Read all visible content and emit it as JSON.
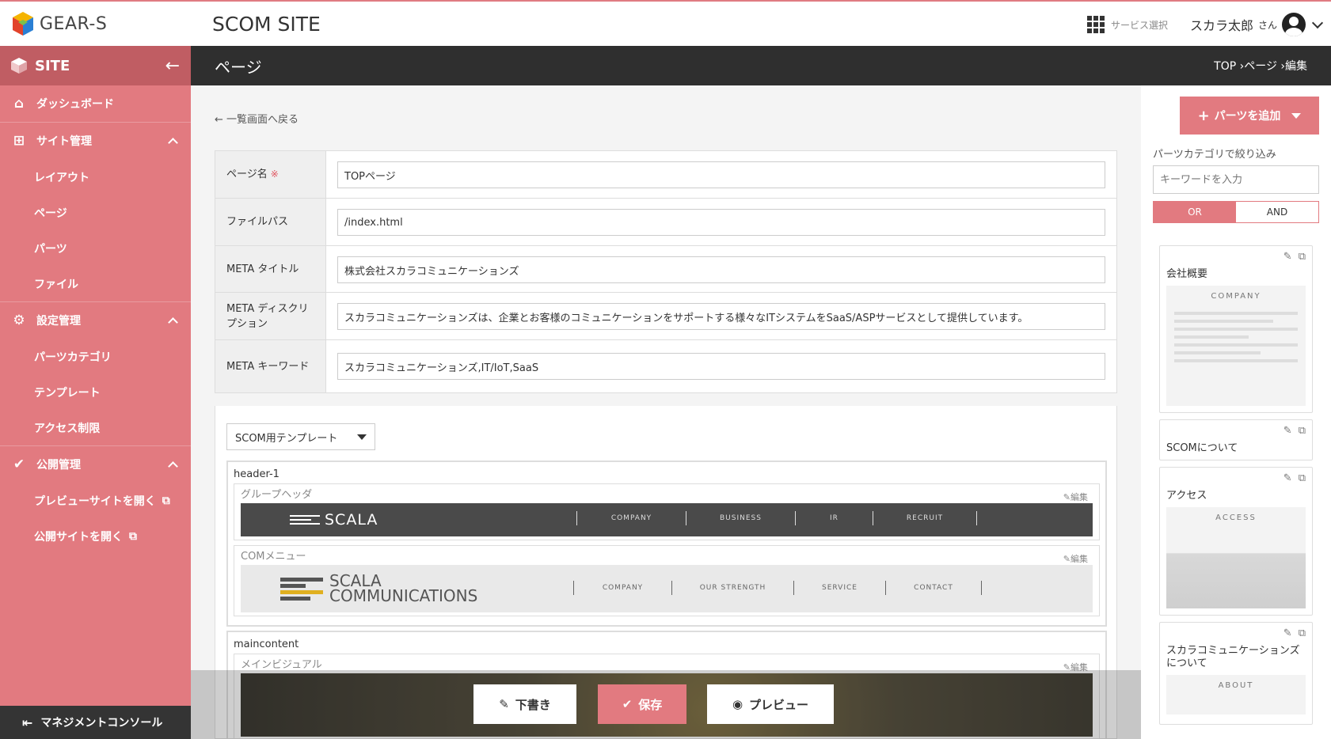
{
  "topbar": {
    "logo_text": "GEAR-S",
    "site_title": "SCOM SITE",
    "service_select": "サービス選択",
    "user_name": "スカラ太郎",
    "user_suffix": "さん"
  },
  "sidebar": {
    "header": "SITE",
    "dashboard": "ダッシュボード",
    "site_mgmt": {
      "label": "サイト管理",
      "items": [
        "レイアウト",
        "ページ",
        "パーツ",
        "ファイル"
      ]
    },
    "settings_mgmt": {
      "label": "設定管理",
      "items": [
        "パーツカテゴリ",
        "テンプレート",
        "アクセス制限"
      ]
    },
    "publish_mgmt": {
      "label": "公開管理",
      "items": [
        "プレビューサイトを開く",
        "公開サイトを開く"
      ]
    },
    "footer": "マネジメントコンソール"
  },
  "page_header": {
    "title": "ページ",
    "breadcrumb": "TOP ›ページ ›編集"
  },
  "main": {
    "back_link": "一覧画面へ戻る",
    "form": {
      "page_name_label": "ページ名",
      "required_mark": "※",
      "page_name_value": "TOPページ",
      "file_path_label": "ファイルパス",
      "file_path_value": "/index.html",
      "meta_title_label": "META タイトル",
      "meta_title_value": "株式会社スカラコミュニケーションズ",
      "meta_desc_label": "META ディスクリプション",
      "meta_desc_value": "スカラコミュニケーションズは、企業とお客様のコミュニケーションをサポートする様々なITシステムをSaaS/ASPサービスとして提供しています。",
      "meta_kw_label": "META キーワード",
      "meta_kw_value": "スカラコミュニケーションズ,IT/IoT,SaaS"
    },
    "template_select": "SCOM用テンプレート",
    "groups": {
      "header": {
        "name": "header-1",
        "parts": {
          "group_header": {
            "name": "グループヘッダ",
            "edit": "編集",
            "logo": "SCALA",
            "nav": [
              "COMPANY",
              "BUSINESS",
              "IR",
              "RECRUIT"
            ]
          },
          "com_menu": {
            "name": "COMメニュー",
            "edit": "編集",
            "logo_line1": "SCALA",
            "logo_line2": "COMMUNICATIONS",
            "nav": [
              "COMPANY",
              "OUR STRENGTH",
              "SERVICE",
              "CONTACT"
            ]
          }
        }
      },
      "main": {
        "name": "maincontent",
        "parts": {
          "main_visual": {
            "name": "メインビジュアル",
            "edit": "編集"
          }
        }
      }
    }
  },
  "actions": {
    "draft": "下書き",
    "save": "保存",
    "preview": "プレビュー"
  },
  "right_panel": {
    "add_parts": "パーツを追加",
    "filter_label": "パーツカテゴリで絞り込み",
    "keyword_placeholder": "キーワードを入力",
    "or": "OR",
    "and": "AND",
    "cards": [
      {
        "title": "会社概要",
        "thumb_label": "COMPANY"
      },
      {
        "title": "SCOMについて"
      },
      {
        "title": "アクセス",
        "thumb_label": "ACCESS"
      },
      {
        "title": "スカラコミュニケーションズについて",
        "thumb_label": "ABOUT"
      }
    ]
  },
  "colors": {
    "accent": "#e27a80",
    "sidebar_dark": "#c05d63",
    "header_dark": "#2f2f2f"
  }
}
